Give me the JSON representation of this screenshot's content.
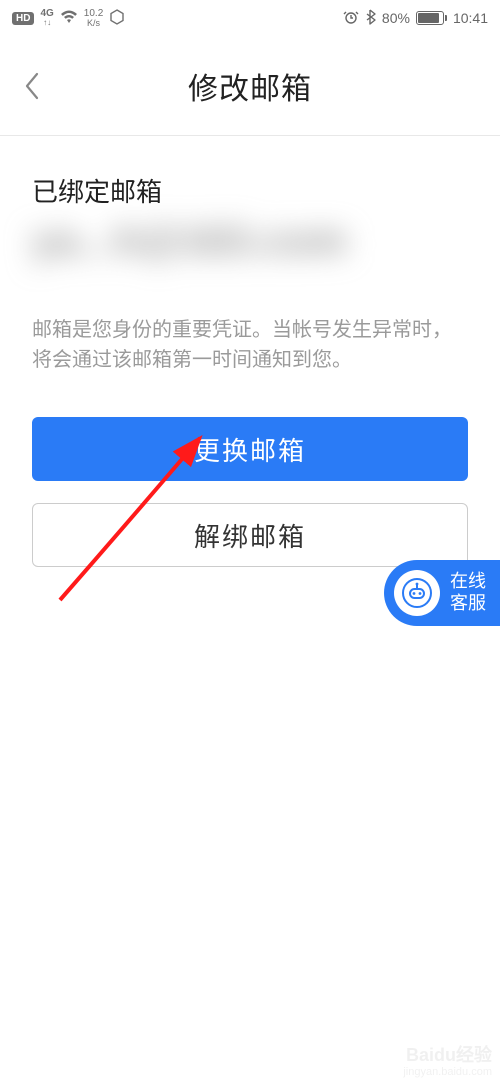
{
  "status_bar": {
    "hd": "HD",
    "net_top": "4G",
    "net_arrows": "↑↓",
    "speed_top": "10.2",
    "speed_unit": "K/s",
    "battery_pct": "80%",
    "time": "10:41"
  },
  "nav": {
    "title": "修改邮箱"
  },
  "content": {
    "section_label": "已绑定邮箱",
    "hint": "邮箱是您身份的重要凭证。当帐号发生异常时，将会通过该邮箱第一时间通知到您。",
    "change_label": "更换邮箱",
    "unbind_label": "解绑邮箱"
  },
  "support": {
    "line1": "在线",
    "line2": "客服"
  },
  "watermark": {
    "brand": "Baidu经验",
    "sub": "jingyan.baidu.com"
  }
}
